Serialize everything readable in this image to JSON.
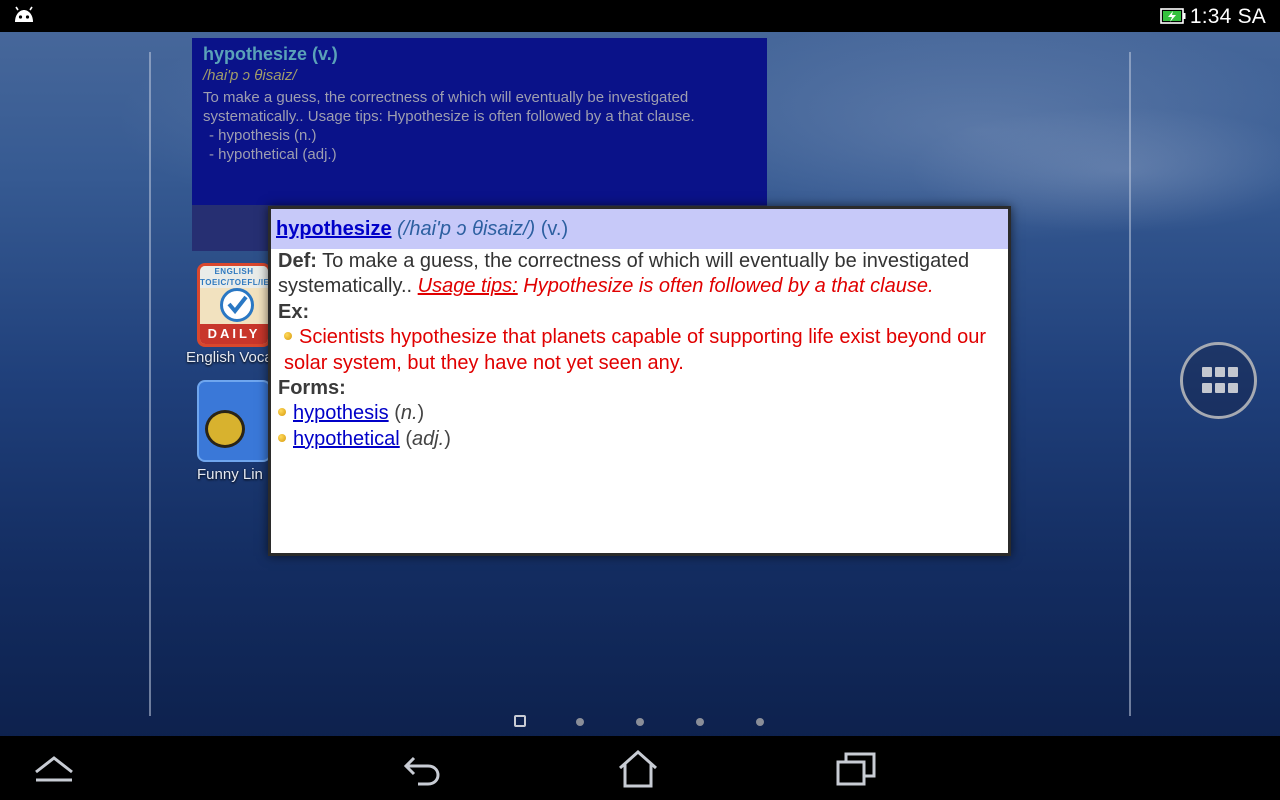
{
  "status_bar": {
    "time": "1:34 SA",
    "icons": [
      "android-icon",
      "battery-charging-icon"
    ]
  },
  "widget": {
    "word": "hypothesize (v.)",
    "phonetic": "/hai'p ɔ θisaiz/",
    "definition": "To make a guess, the correctness of which will eventually be investigated systematically.. Usage tips: Hypothesize is often followed by a that clause.",
    "forms": [
      "- hypothesis (n.)",
      "- hypothetical (adj.)"
    ]
  },
  "apps": [
    {
      "label": "English Voca",
      "icon": "english-vocabulary-daily-icon",
      "banner": "ENGLISH TOEIC/TOEFL/IELTS",
      "badge": "DAILY"
    },
    {
      "label": "Funny Lin",
      "icon": "ladybug-game-icon"
    }
  ],
  "popup": {
    "word": "hypothesize",
    "phonetic": "(/hai'p ɔ θisaiz/)",
    "pos": "(v.)",
    "def_label": "Def:",
    "def_text": "To make a guess, the correctness of which will eventually be investigated systematically..",
    "usage_label": "Usage tips:",
    "usage_text": "Hypothesize is often followed by a that clause",
    "usage_end": ".",
    "ex_label": "Ex:",
    "examples": [
      "Scientists hypothesize that planets capable of supporting life exist beyond our solar system, but they have not yet seen any."
    ],
    "forms_label": "Forms:",
    "forms": [
      {
        "word": "hypothesis",
        "pos": "(n.)"
      },
      {
        "word": "hypothetical",
        "pos": "(adj.)"
      }
    ]
  },
  "home": {
    "all_apps_icon": "all-apps-grid-icon",
    "page_count": 5,
    "current_page": 1
  },
  "nav": {
    "icons": [
      "menu-up-icon",
      "back-icon",
      "home-icon",
      "recent-apps-icon"
    ]
  }
}
